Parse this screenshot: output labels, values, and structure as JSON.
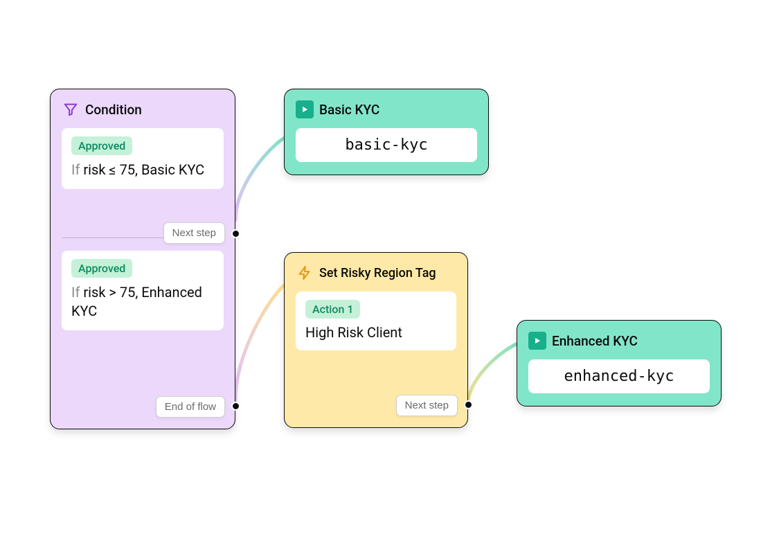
{
  "condition": {
    "title": "Condition",
    "rules": [
      {
        "status_label": "Approved",
        "if_label": "If",
        "rule_text": "risk ≤ 75, Basic KYC",
        "port_label": "Next step"
      },
      {
        "status_label": "Approved",
        "if_label": "If",
        "rule_text": "risk > 75, Enhanced KYC",
        "port_label": "End of flow"
      }
    ]
  },
  "basic_kyc": {
    "title": "Basic KYC",
    "slug": "basic-kyc"
  },
  "risky_tag": {
    "title": "Set Risky Region Tag",
    "action_label": "Action 1",
    "action_text": "High Risk Client",
    "port_label": "Next step"
  },
  "enhanced_kyc": {
    "title": "Enhanced KYC",
    "slug": "enhanced-kyc"
  },
  "colors": {
    "purple": "#ecd8fb",
    "teal": "#81e6c9",
    "yellow": "#ffe9a8",
    "badge_green_bg": "#c5f1d9",
    "badge_green_fg": "#0d8a5f",
    "play_green": "#17b08a"
  }
}
